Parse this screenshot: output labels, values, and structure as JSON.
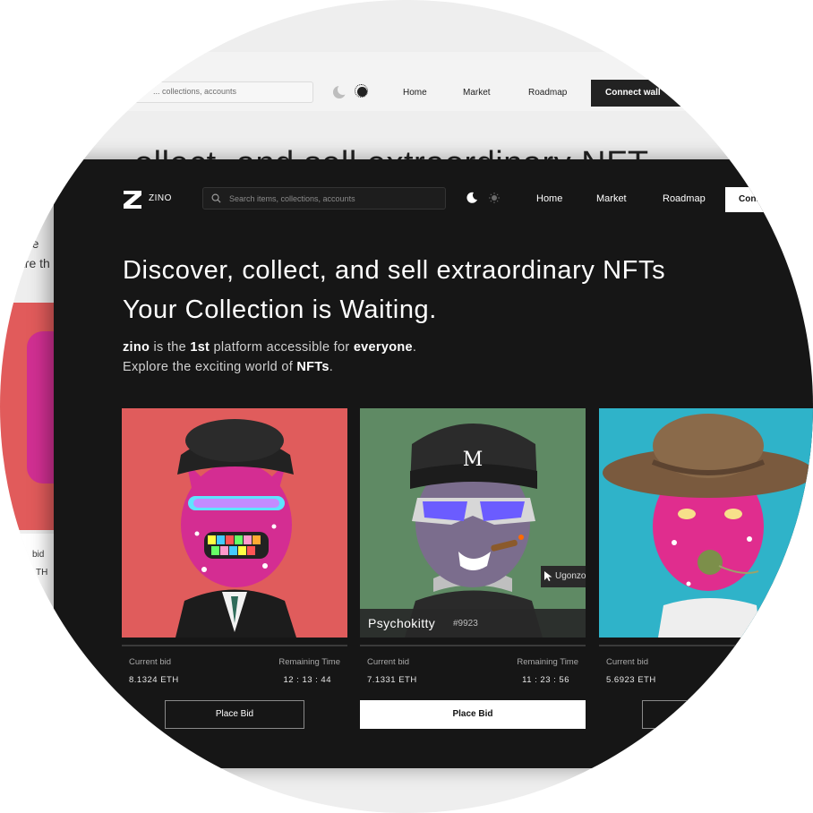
{
  "light": {
    "search_placeholder": "... collections, accounts",
    "nav": [
      "Home",
      "Market",
      "Roadmap"
    ],
    "connect_label": "Connect wall",
    "heading": "ollect, and sell extraordinary NFT",
    "left_text": [
      "the",
      "are th"
    ],
    "left_bottom": [
      "bid",
      "TH"
    ]
  },
  "header": {
    "logo_text": "ZINO",
    "search_placeholder": "Search items, collections, accounts",
    "nav": [
      "Home",
      "Market",
      "Roadmap"
    ],
    "connect_label": "Connect"
  },
  "hero": {
    "line1": "Discover, collect, and sell extraordinary NFTs",
    "line2": "Your Collection is Waiting.",
    "sub1": {
      "brand": "zino",
      "t1": " is the ",
      "em": "1st",
      "t2": " platform accessible for ",
      "em2": "everyone",
      "t3": "."
    },
    "sub2": {
      "t1": "Explore the exciting world of ",
      "em": "NFTs",
      "t2": "."
    }
  },
  "cards": [
    {
      "bg": "#e05c5c",
      "bid_label": "Current bid",
      "bid_value": "8.1324  ETH",
      "time_label": "Remaining Time",
      "time_value": "12  :  13  :  44",
      "button": "Place Bid"
    },
    {
      "bg": "#5f8a64",
      "name": "Psychokitty",
      "number": "#9923",
      "tooltip": "Ugonzo Art",
      "bid_label": "Current bid",
      "bid_value": "7.1331  ETH",
      "time_label": "Remaining Time",
      "time_value": "11  :  23  :  56",
      "button": "Place Bid"
    },
    {
      "bg": "#2fb3c9",
      "bid_label": "Current bid",
      "bid_value": "5.6923  ETH"
    }
  ]
}
